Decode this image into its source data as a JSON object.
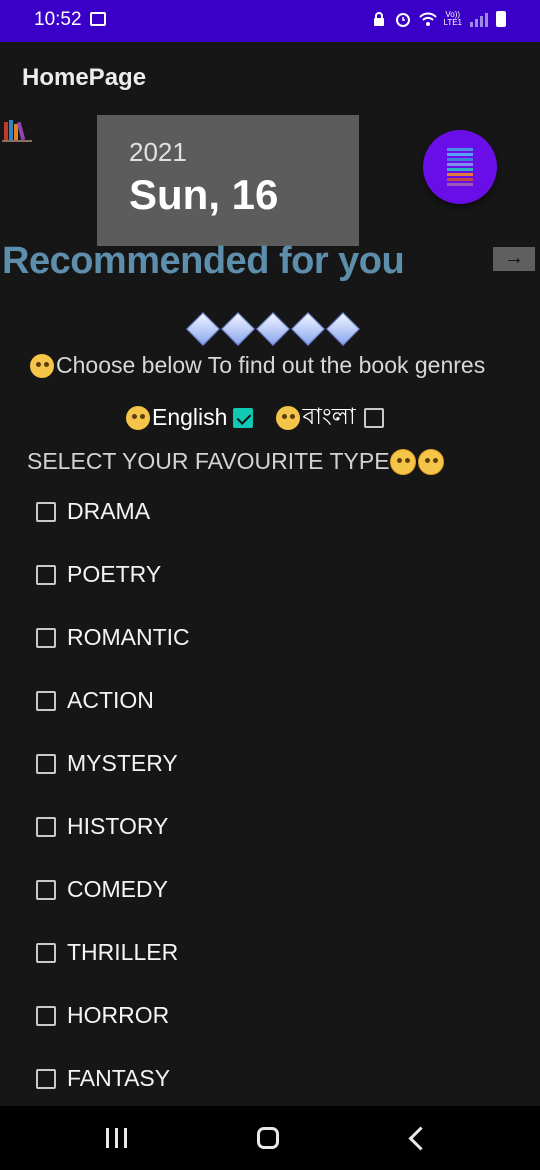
{
  "status_bar": {
    "time": "10:52",
    "volte_top": "Vo))",
    "volte_bottom": "LTE1"
  },
  "app_bar": {
    "title": "HomePage"
  },
  "date_card": {
    "year": "2021",
    "day": "Sun, 16"
  },
  "recommend": {
    "title": "Recommended for you",
    "arrow": "→"
  },
  "choose": {
    "text": "Choose below  To find out the book genres"
  },
  "languages": [
    {
      "label": "English",
      "checked": true
    },
    {
      "label": "বাংলা",
      "checked": false
    }
  ],
  "select_title": "SELECT YOUR FAVOURITE TYPE",
  "genres": [
    {
      "label": "DRAMA",
      "checked": false
    },
    {
      "label": "POETRY",
      "checked": false
    },
    {
      "label": "ROMANTIC",
      "checked": false
    },
    {
      "label": "ACTION",
      "checked": false
    },
    {
      "label": "MYSTERY",
      "checked": false
    },
    {
      "label": "HISTORY",
      "checked": false
    },
    {
      "label": "COMEDY",
      "checked": false
    },
    {
      "label": "THRILLER",
      "checked": false
    },
    {
      "label": "HORROR",
      "checked": false
    },
    {
      "label": "FANTASY",
      "checked": false
    }
  ],
  "colors": {
    "accent": "#10c9b4",
    "status_bar": "#3a00c8",
    "fab": "#6a0ee8",
    "recommend_text": "#5d8fad"
  }
}
